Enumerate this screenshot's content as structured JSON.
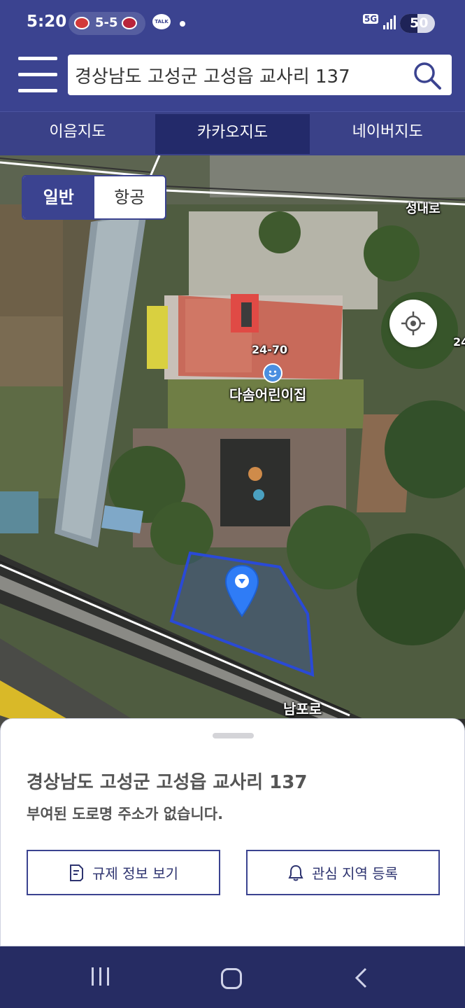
{
  "status_bar": {
    "time": "5:20",
    "score": "5-5",
    "talk_badge": "TALK",
    "network": "5G",
    "battery": "50"
  },
  "header": {
    "menu_icon": "hamburger-menu-icon",
    "search_value": "경상남도 고성군 고성읍 교사리 137",
    "search_icon": "search-icon"
  },
  "map_tabs": [
    {
      "label": "이음지도",
      "active": false
    },
    {
      "label": "카카오지도",
      "active": true
    },
    {
      "label": "네이버지도",
      "active": false
    }
  ],
  "map": {
    "type_toggle": {
      "general": "일반",
      "aerial": "항공",
      "selected": "일반"
    },
    "labels": {
      "road_north": "성내로",
      "road_south": "남포로",
      "lot_number": "24-70",
      "lot_number_edge": "24",
      "poi_name": "다솜어린이집"
    },
    "locate_icon": "crosshair-icon",
    "marker_icon": "map-pin-icon",
    "parcel_color": "#3355dd"
  },
  "bottom_sheet": {
    "address": "경상남도 고성군 고성읍 교사리 137",
    "road_address_note": "부여된 도로명 주소가 없습니다.",
    "buttons": {
      "regulation": "규제 정보 보기",
      "interest": "관심 지역 등록"
    }
  },
  "colors": {
    "brand": "#3b4390",
    "brand_dark": "#232a6a",
    "button_border": "#3b4390"
  }
}
